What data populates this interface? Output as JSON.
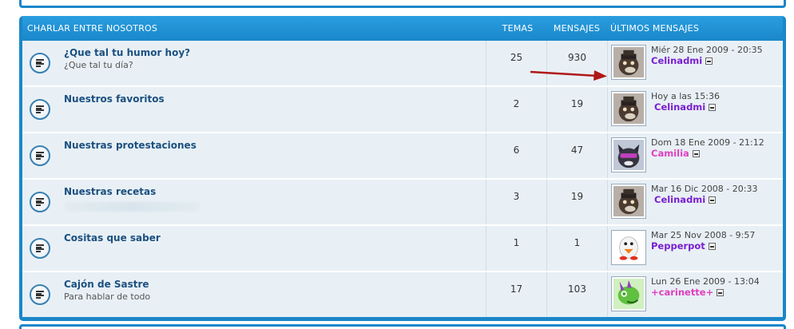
{
  "forum": {
    "category": "CHARLAR ENTRE NOSOTROS",
    "columns": {
      "topics": "TEMAS",
      "posts": "MENSAJES",
      "last": "ÚLTIMOS MENSAJES"
    },
    "accent_color": "#1a87c9",
    "rows": [
      {
        "title": "¿Que tal tu humor hoy?",
        "description": "¿Que tal tu día?",
        "topics": "25",
        "posts": "930",
        "last_date": "Miér 28 Ene 2009 - 20:35",
        "last_user": "Celinadmi",
        "user_color": "#7a1fd0",
        "avatar": "dog-avatar"
      },
      {
        "title": "Nuestros favoritos",
        "description": "",
        "topics": "2",
        "posts": "19",
        "last_date": "Hoy a las 15:36",
        "last_user": "Celinadmi",
        "user_color": "#7a1fd0",
        "avatar": "dog-avatar"
      },
      {
        "title": "Nuestras protestaciones",
        "description": "",
        "topics": "6",
        "posts": "47",
        "last_date": "Dom 18 Ene 2009 - 21:12",
        "last_user": "Camilia",
        "user_color": "#e040c0",
        "avatar": "cat-avatar"
      },
      {
        "title": "Nuestras recetas",
        "description": "",
        "topics": "3",
        "posts": "19",
        "last_date": "Mar 16 Dic 2008 - 20:33",
        "last_user": "Celinadmi",
        "user_color": "#7a1fd0",
        "avatar": "dog-avatar"
      },
      {
        "title": "Cositas que saber",
        "description": "",
        "topics": "1",
        "posts": "1",
        "last_date": "Mar 25 Nov 2008 - 9:57",
        "last_user": "Pepperpot",
        "user_color": "#7a1fd0",
        "avatar": "penguin-avatar"
      },
      {
        "title": "Cajón de Sastre",
        "description": "Para hablar de todo",
        "topics": "17",
        "posts": "103",
        "last_date": "Lun 26 Ene 2009 - 13:04",
        "last_user": "+carinette+",
        "user_color": "#e040c0",
        "avatar": "dragon-avatar"
      }
    ]
  }
}
